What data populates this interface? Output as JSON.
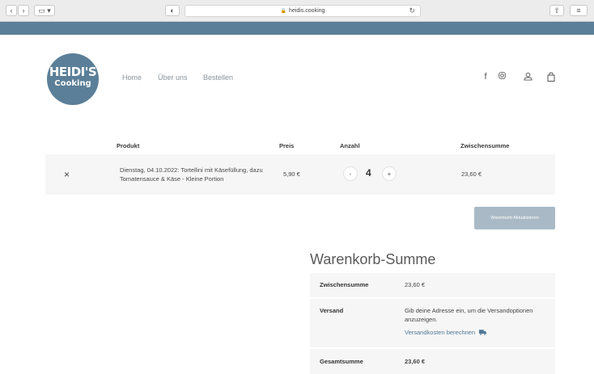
{
  "browser": {
    "url": "heidis.cooking"
  },
  "header": {
    "logo_line1": "HEIDI'S",
    "logo_line2": "Cooking",
    "nav": [
      "Home",
      "Über uns",
      "Bestellen"
    ]
  },
  "cart": {
    "columns": {
      "product": "Produkt",
      "price": "Preis",
      "quantity": "Anzahl",
      "subtotal": "Zwischensumme"
    },
    "item": {
      "remove": "×",
      "name": "Dienstag, 04.10.2022: Tortellini mit Käsefüllung, dazu Tomatensauce & Käse - Kleine Portion",
      "price": "5,90 €",
      "quantity": "4",
      "minus": "-",
      "plus": "+",
      "subtotal": "23,60 €"
    },
    "update_button": "Warenkorb Aktualisieren"
  },
  "totals": {
    "title": "Warenkorb-Summe",
    "subtotal_label": "Zwischensumme",
    "subtotal_value": "23,60 €",
    "shipping_label": "Versand",
    "shipping_text": "Gib deine Adresse ein, um die Versandoptionen anzuzeigen.",
    "shipping_link": "Versandkosten berechnen",
    "total_label": "Gesamtsumme",
    "total_value": "23,60 €"
  },
  "colors": {
    "brand": "#5b7f98",
    "button": "#a9bac6",
    "link": "#4e7896"
  }
}
